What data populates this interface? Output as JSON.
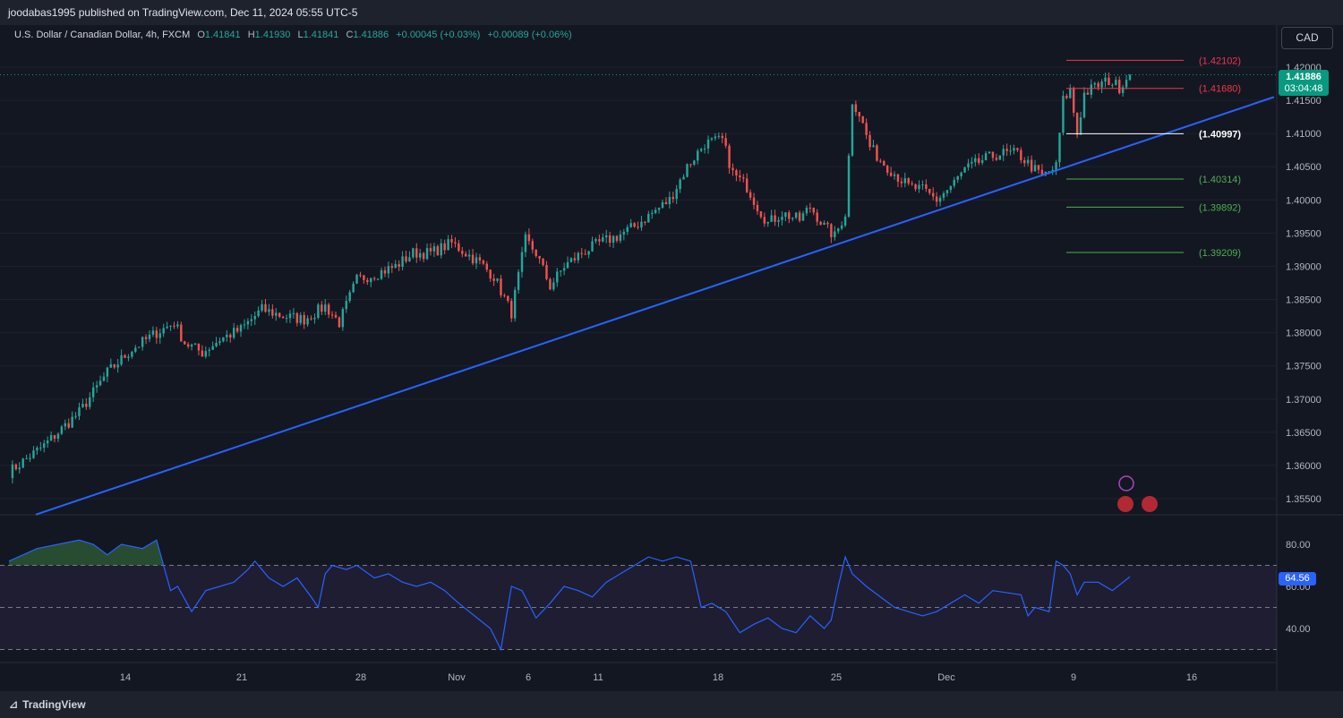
{
  "header": {
    "publisher": "joodabas1995 published on TradingView.com, Dec 11, 2024 05:55 UTC-5",
    "symbol": "U.S. Dollar / Canadian Dollar, 4h, FXCM",
    "open_label": "O",
    "open": "1.41841",
    "high_label": "H",
    "high": "1.41930",
    "low_label": "L",
    "low": "1.41841",
    "close_label": "C",
    "close": "1.41886",
    "change": "+0.00045 (+0.03%)",
    "change2": "+0.00089 (+0.06%)",
    "currency_button": "CAD"
  },
  "footer": {
    "brand": "TradingView"
  },
  "colors": {
    "background": "#131722",
    "up": "#26a69a",
    "down": "#ef5350",
    "trendline": "#2962ff",
    "rsi": "#2962ff"
  },
  "chart_data": [
    {
      "type": "candlestick",
      "series": [
        {
          "name": "U.S. Dollar / Canadian Dollar, 4h, FXCM"
        }
      ],
      "y_ticks": [
        "1.42000",
        "1.41500",
        "1.41000",
        "1.40500",
        "1.40000",
        "1.39500",
        "1.39000",
        "1.38500",
        "1.38000",
        "1.37500",
        "1.37000",
        "1.36500",
        "1.36000",
        "1.35500"
      ],
      "y_range": [
        1.352,
        1.4235
      ],
      "x_ticks": [
        "14",
        "21",
        "28",
        "Nov",
        "6",
        "11",
        "18",
        "25",
        "Dec",
        "9",
        "16"
      ],
      "last_price": "1.41886",
      "countdown": "03:04:48",
      "price_path": [
        [
          0,
          1.359
        ],
        [
          10,
          1.363
        ],
        [
          20,
          1.368
        ],
        [
          28,
          1.374
        ],
        [
          35,
          1.3775
        ],
        [
          42,
          1.38
        ],
        [
          47,
          1.3815
        ],
        [
          50,
          1.3785
        ],
        [
          55,
          1.377
        ],
        [
          60,
          1.379
        ],
        [
          66,
          1.3805
        ],
        [
          72,
          1.3835
        ],
        [
          78,
          1.3825
        ],
        [
          84,
          1.382
        ],
        [
          90,
          1.384
        ],
        [
          94,
          1.3815
        ],
        [
          99,
          1.388
        ],
        [
          105,
          1.389
        ],
        [
          110,
          1.39
        ],
        [
          115,
          1.392
        ],
        [
          120,
          1.392
        ],
        [
          126,
          1.3935
        ],
        [
          130,
          1.392
        ],
        [
          134,
          1.3905
        ],
        [
          138,
          1.3885
        ],
        [
          143,
          1.383
        ],
        [
          147,
          1.394
        ],
        [
          150,
          1.392
        ],
        [
          154,
          1.387
        ],
        [
          158,
          1.39
        ],
        [
          163,
          1.392
        ],
        [
          168,
          1.3935
        ],
        [
          173,
          1.3945
        ],
        [
          178,
          1.396
        ],
        [
          183,
          1.398
        ],
        [
          188,
          1.4
        ],
        [
          193,
          1.405
        ],
        [
          198,
          1.4085
        ],
        [
          203,
          1.409
        ],
        [
          206,
          1.404
        ],
        [
          210,
          1.402
        ],
        [
          213,
          1.399
        ],
        [
          216,
          1.3965
        ],
        [
          220,
          1.398
        ],
        [
          225,
          1.397
        ],
        [
          228,
          1.399
        ],
        [
          232,
          1.396
        ],
        [
          235,
          1.3945
        ],
        [
          238,
          1.398
        ],
        [
          240,
          1.415
        ],
        [
          242,
          1.413
        ],
        [
          245,
          1.408
        ],
        [
          248,
          1.406
        ],
        [
          252,
          1.404
        ],
        [
          256,
          1.402
        ],
        [
          260,
          1.4015
        ],
        [
          264,
          1.4
        ],
        [
          268,
          1.402
        ],
        [
          272,
          1.4045
        ],
        [
          277,
          1.406
        ],
        [
          282,
          1.407
        ],
        [
          287,
          1.407
        ],
        [
          291,
          1.405
        ],
        [
          294,
          1.4035
        ],
        [
          298,
          1.405
        ],
        [
          300,
          1.415
        ],
        [
          302,
          1.4165
        ],
        [
          304,
          1.41
        ],
        [
          306,
          1.416
        ],
        [
          309,
          1.417
        ],
        [
          313,
          1.418
        ],
        [
          316,
          1.417
        ],
        [
          319,
          1.4189
        ]
      ],
      "horizontal_levels": [
        {
          "label": "(1.42102)",
          "price": 1.42102,
          "color": "#f23645"
        },
        {
          "label": "(1.41680)",
          "price": 1.4168,
          "color": "#f23645"
        },
        {
          "label": "(1.40997)",
          "price": 1.40997,
          "color": "#ffffff"
        },
        {
          "label": "(1.40314)",
          "price": 1.40314,
          "color": "#4caf50"
        },
        {
          "label": "(1.39892)",
          "price": 1.39892,
          "color": "#4caf50"
        },
        {
          "label": "(1.39209)",
          "price": 1.39209,
          "color": "#4caf50"
        }
      ],
      "trendline": [
        [
          1.3526,
          0
        ],
        [
          1.4155,
          360
        ]
      ]
    },
    {
      "type": "line",
      "series": [
        {
          "name": "RSI"
        }
      ],
      "y_ticks": [
        "80.00",
        "60.00",
        "40.00"
      ],
      "y_range": [
        27,
        85
      ],
      "bands": [
        70,
        50,
        30
      ],
      "last_value": "64.56",
      "rsi_path": [
        [
          0,
          72
        ],
        [
          8,
          78
        ],
        [
          14,
          80
        ],
        [
          20,
          82
        ],
        [
          24,
          80
        ],
        [
          28,
          75
        ],
        [
          32,
          80
        ],
        [
          38,
          78
        ],
        [
          42,
          82
        ],
        [
          44,
          70
        ],
        [
          46,
          58
        ],
        [
          48,
          60
        ],
        [
          52,
          48
        ],
        [
          56,
          58
        ],
        [
          60,
          60
        ],
        [
          64,
          62
        ],
        [
          68,
          68
        ],
        [
          70,
          72
        ],
        [
          74,
          64
        ],
        [
          78,
          60
        ],
        [
          82,
          64
        ],
        [
          86,
          55
        ],
        [
          88,
          50
        ],
        [
          90,
          66
        ],
        [
          92,
          70
        ],
        [
          96,
          68
        ],
        [
          99,
          70
        ],
        [
          104,
          64
        ],
        [
          108,
          66
        ],
        [
          112,
          62
        ],
        [
          116,
          60
        ],
        [
          120,
          62
        ],
        [
          124,
          58
        ],
        [
          128,
          52
        ],
        [
          131,
          48
        ],
        [
          134,
          44
        ],
        [
          137,
          40
        ],
        [
          140,
          30
        ],
        [
          143,
          60
        ],
        [
          146,
          58
        ],
        [
          150,
          45
        ],
        [
          154,
          52
        ],
        [
          158,
          60
        ],
        [
          162,
          58
        ],
        [
          166,
          55
        ],
        [
          170,
          62
        ],
        [
          174,
          66
        ],
        [
          178,
          70
        ],
        [
          182,
          74
        ],
        [
          186,
          72
        ],
        [
          190,
          74
        ],
        [
          194,
          72
        ],
        [
          197,
          50
        ],
        [
          200,
          52
        ],
        [
          204,
          48
        ],
        [
          208,
          38
        ],
        [
          212,
          42
        ],
        [
          216,
          45
        ],
        [
          220,
          40
        ],
        [
          224,
          38
        ],
        [
          228,
          46
        ],
        [
          232,
          40
        ],
        [
          234,
          44
        ],
        [
          236,
          60
        ],
        [
          238,
          74
        ],
        [
          240,
          66
        ],
        [
          244,
          60
        ],
        [
          248,
          55
        ],
        [
          252,
          50
        ],
        [
          256,
          48
        ],
        [
          260,
          46
        ],
        [
          264,
          48
        ],
        [
          268,
          52
        ],
        [
          272,
          56
        ],
        [
          276,
          52
        ],
        [
          280,
          58
        ],
        [
          284,
          57
        ],
        [
          288,
          56
        ],
        [
          290,
          46
        ],
        [
          292,
          50
        ],
        [
          296,
          48
        ],
        [
          298,
          72
        ],
        [
          300,
          70
        ],
        [
          302,
          66
        ],
        [
          304,
          56
        ],
        [
          306,
          62
        ],
        [
          310,
          62
        ],
        [
          314,
          58
        ],
        [
          319,
          64.56
        ]
      ]
    }
  ]
}
